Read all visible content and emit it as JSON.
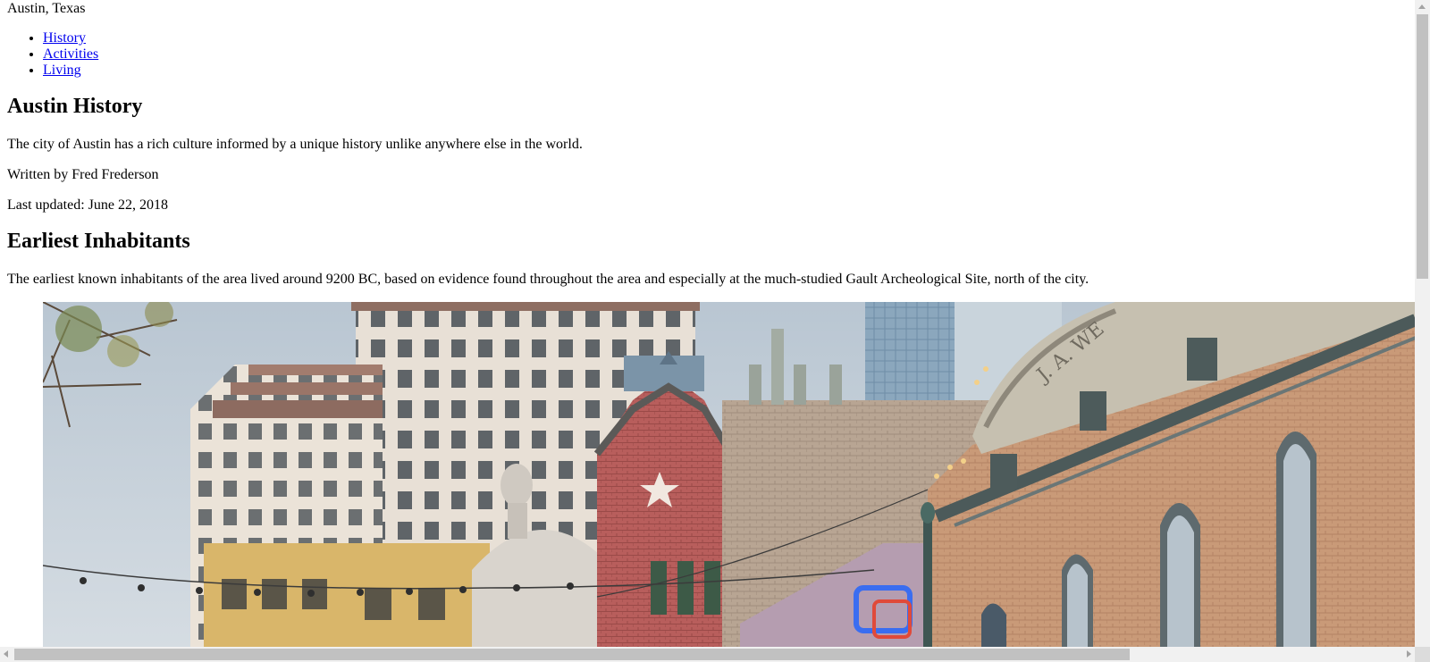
{
  "header": {
    "site_title": "Austin, Texas"
  },
  "nav": {
    "items": [
      {
        "label": "History"
      },
      {
        "label": "Activities"
      },
      {
        "label": "Living"
      }
    ]
  },
  "article": {
    "title": "Austin History",
    "intro": "The city of Austin has a rich culture informed by a unique history unlike anywhere else in the world.",
    "author": "Written by Fred Frederson",
    "updated": "Last updated: June 22, 2018"
  },
  "section": {
    "title": "Earliest Inhabitants",
    "body": "The earliest known inhabitants of the area lived around 9200 BC, based on evidence found throughout the area and especially at the much-studied Gault Archeological Site, north of the city."
  },
  "photo": {
    "sign_text": "J. A. WE",
    "icon": "austin-street-photo"
  }
}
